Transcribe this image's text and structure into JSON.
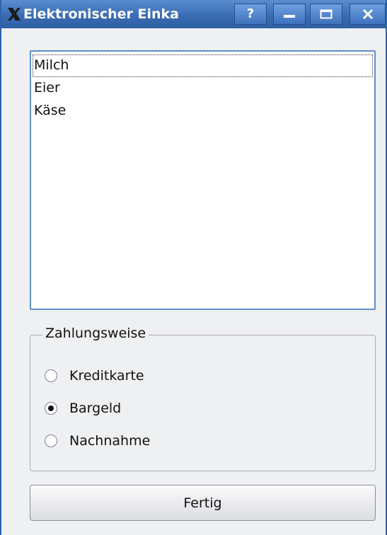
{
  "window": {
    "title": "Elektronischer Einka",
    "buttons": {
      "help_label": "?"
    }
  },
  "list": {
    "items": [
      "Milch",
      "Eier",
      "Käse"
    ],
    "focused_index": 0
  },
  "payment": {
    "title": "Zahlungsweise",
    "options": [
      {
        "label": "Kreditkarte",
        "checked": false
      },
      {
        "label": "Bargeld",
        "checked": true
      },
      {
        "label": "Nachnahme",
        "checked": false
      }
    ]
  },
  "actions": {
    "done_label": "Fertig"
  },
  "icons": {
    "app": "x-window-icon",
    "help": "help-icon",
    "minimize": "minimize-icon",
    "maximize": "maximize-icon",
    "close": "close-icon"
  },
  "colors": {
    "titlebar": "#3a6cb4",
    "window_bg": "#eff0f2",
    "list_border": "#5f8fcb"
  }
}
